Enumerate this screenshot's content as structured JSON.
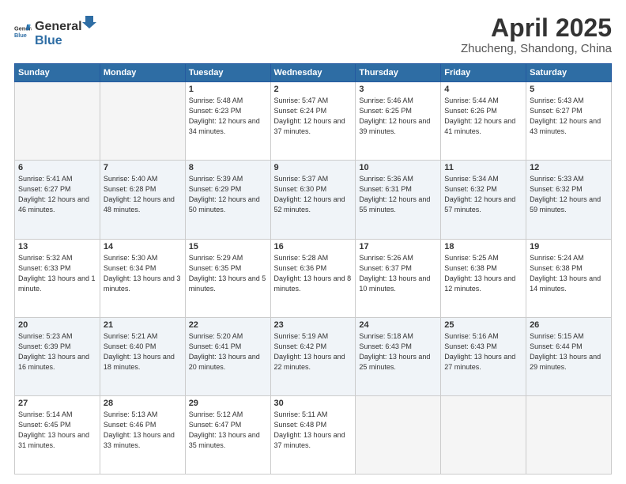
{
  "header": {
    "logo_general": "General",
    "logo_blue": "Blue",
    "title": "April 2025",
    "location": "Zhucheng, Shandong, China"
  },
  "weekdays": [
    "Sunday",
    "Monday",
    "Tuesday",
    "Wednesday",
    "Thursday",
    "Friday",
    "Saturday"
  ],
  "weeks": [
    [
      {
        "day": "",
        "empty": true
      },
      {
        "day": "",
        "empty": true
      },
      {
        "day": "1",
        "sunrise": "5:48 AM",
        "sunset": "6:23 PM",
        "daylight": "12 hours and 34 minutes."
      },
      {
        "day": "2",
        "sunrise": "5:47 AM",
        "sunset": "6:24 PM",
        "daylight": "12 hours and 37 minutes."
      },
      {
        "day": "3",
        "sunrise": "5:46 AM",
        "sunset": "6:25 PM",
        "daylight": "12 hours and 39 minutes."
      },
      {
        "day": "4",
        "sunrise": "5:44 AM",
        "sunset": "6:26 PM",
        "daylight": "12 hours and 41 minutes."
      },
      {
        "day": "5",
        "sunrise": "5:43 AM",
        "sunset": "6:27 PM",
        "daylight": "12 hours and 43 minutes."
      }
    ],
    [
      {
        "day": "6",
        "sunrise": "5:41 AM",
        "sunset": "6:27 PM",
        "daylight": "12 hours and 46 minutes."
      },
      {
        "day": "7",
        "sunrise": "5:40 AM",
        "sunset": "6:28 PM",
        "daylight": "12 hours and 48 minutes."
      },
      {
        "day": "8",
        "sunrise": "5:39 AM",
        "sunset": "6:29 PM",
        "daylight": "12 hours and 50 minutes."
      },
      {
        "day": "9",
        "sunrise": "5:37 AM",
        "sunset": "6:30 PM",
        "daylight": "12 hours and 52 minutes."
      },
      {
        "day": "10",
        "sunrise": "5:36 AM",
        "sunset": "6:31 PM",
        "daylight": "12 hours and 55 minutes."
      },
      {
        "day": "11",
        "sunrise": "5:34 AM",
        "sunset": "6:32 PM",
        "daylight": "12 hours and 57 minutes."
      },
      {
        "day": "12",
        "sunrise": "5:33 AM",
        "sunset": "6:32 PM",
        "daylight": "12 hours and 59 minutes."
      }
    ],
    [
      {
        "day": "13",
        "sunrise": "5:32 AM",
        "sunset": "6:33 PM",
        "daylight": "13 hours and 1 minute."
      },
      {
        "day": "14",
        "sunrise": "5:30 AM",
        "sunset": "6:34 PM",
        "daylight": "13 hours and 3 minutes."
      },
      {
        "day": "15",
        "sunrise": "5:29 AM",
        "sunset": "6:35 PM",
        "daylight": "13 hours and 5 minutes."
      },
      {
        "day": "16",
        "sunrise": "5:28 AM",
        "sunset": "6:36 PM",
        "daylight": "13 hours and 8 minutes."
      },
      {
        "day": "17",
        "sunrise": "5:26 AM",
        "sunset": "6:37 PM",
        "daylight": "13 hours and 10 minutes."
      },
      {
        "day": "18",
        "sunrise": "5:25 AM",
        "sunset": "6:38 PM",
        "daylight": "13 hours and 12 minutes."
      },
      {
        "day": "19",
        "sunrise": "5:24 AM",
        "sunset": "6:38 PM",
        "daylight": "13 hours and 14 minutes."
      }
    ],
    [
      {
        "day": "20",
        "sunrise": "5:23 AM",
        "sunset": "6:39 PM",
        "daylight": "13 hours and 16 minutes."
      },
      {
        "day": "21",
        "sunrise": "5:21 AM",
        "sunset": "6:40 PM",
        "daylight": "13 hours and 18 minutes."
      },
      {
        "day": "22",
        "sunrise": "5:20 AM",
        "sunset": "6:41 PM",
        "daylight": "13 hours and 20 minutes."
      },
      {
        "day": "23",
        "sunrise": "5:19 AM",
        "sunset": "6:42 PM",
        "daylight": "13 hours and 22 minutes."
      },
      {
        "day": "24",
        "sunrise": "5:18 AM",
        "sunset": "6:43 PM",
        "daylight": "13 hours and 25 minutes."
      },
      {
        "day": "25",
        "sunrise": "5:16 AM",
        "sunset": "6:43 PM",
        "daylight": "13 hours and 27 minutes."
      },
      {
        "day": "26",
        "sunrise": "5:15 AM",
        "sunset": "6:44 PM",
        "daylight": "13 hours and 29 minutes."
      }
    ],
    [
      {
        "day": "27",
        "sunrise": "5:14 AM",
        "sunset": "6:45 PM",
        "daylight": "13 hours and 31 minutes."
      },
      {
        "day": "28",
        "sunrise": "5:13 AM",
        "sunset": "6:46 PM",
        "daylight": "13 hours and 33 minutes."
      },
      {
        "day": "29",
        "sunrise": "5:12 AM",
        "sunset": "6:47 PM",
        "daylight": "13 hours and 35 minutes."
      },
      {
        "day": "30",
        "sunrise": "5:11 AM",
        "sunset": "6:48 PM",
        "daylight": "13 hours and 37 minutes."
      },
      {
        "day": "",
        "empty": true
      },
      {
        "day": "",
        "empty": true
      },
      {
        "day": "",
        "empty": true
      }
    ]
  ],
  "labels": {
    "sunrise": "Sunrise:",
    "sunset": "Sunset:",
    "daylight": "Daylight:"
  }
}
